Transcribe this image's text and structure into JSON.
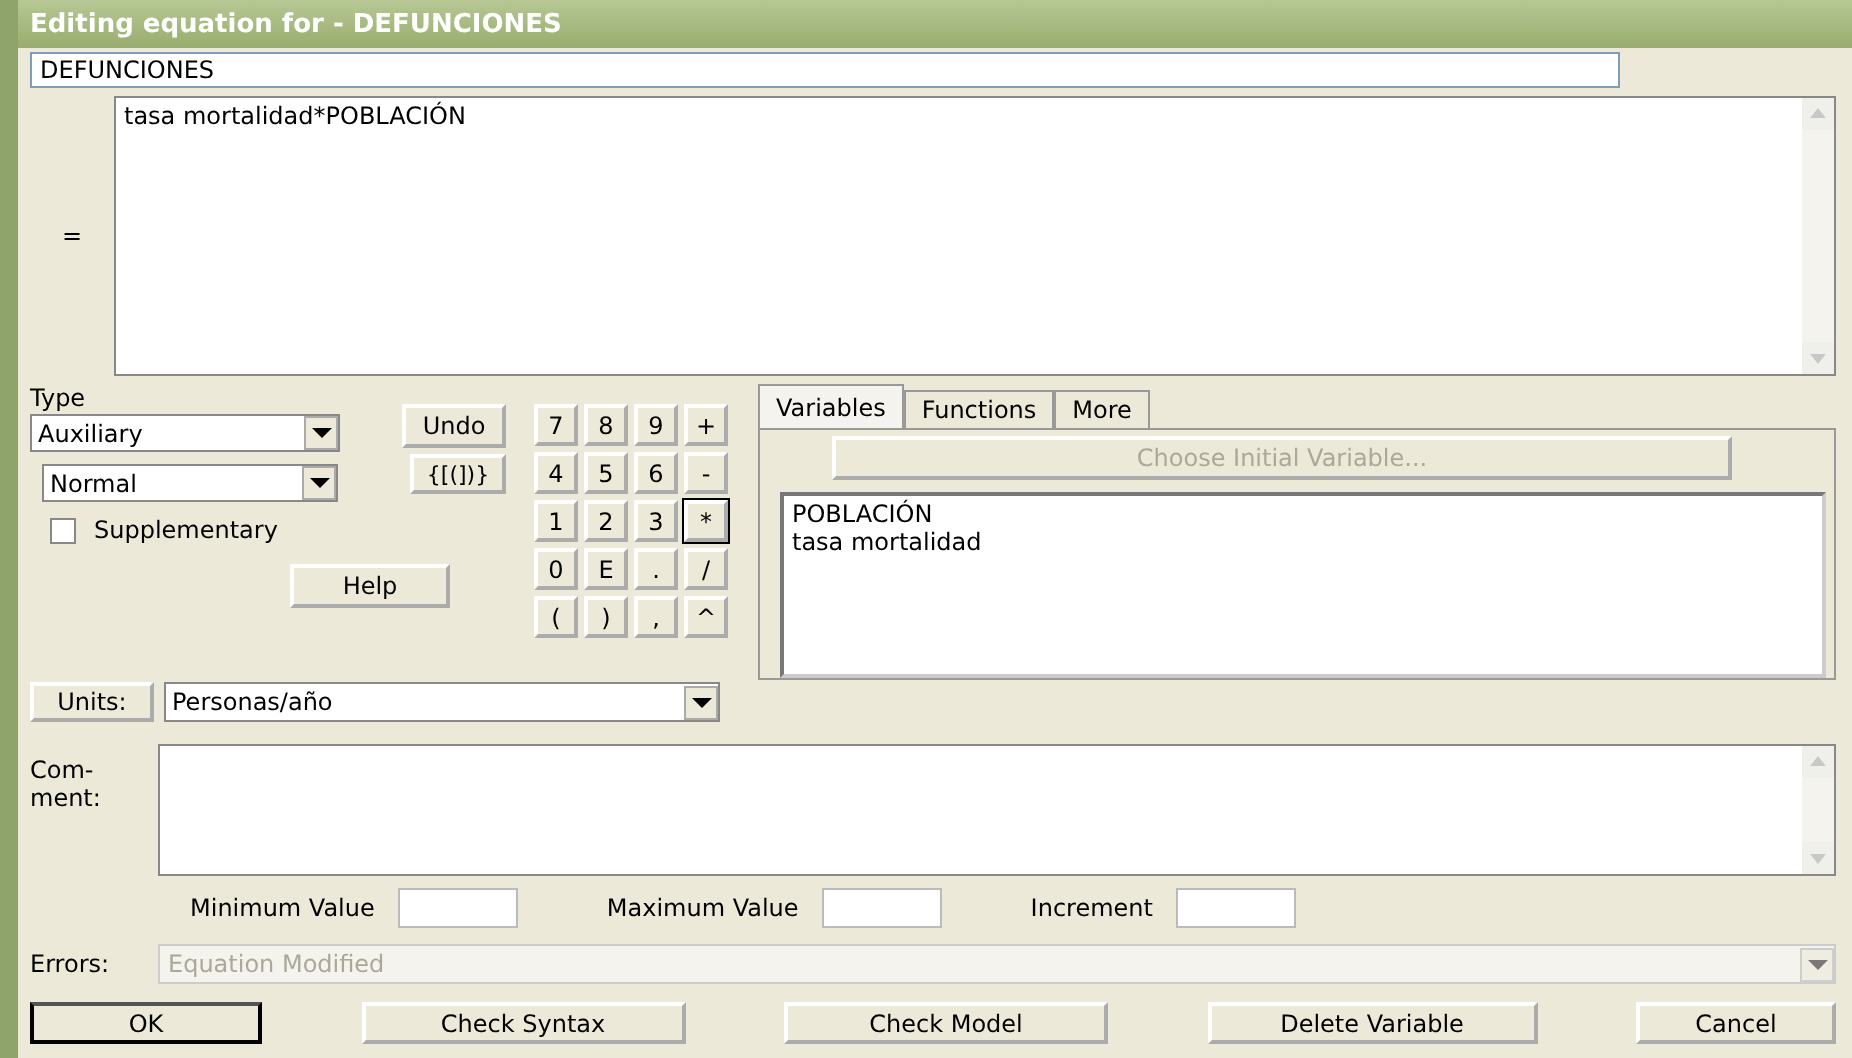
{
  "window": {
    "title": "Editing equation for - DEFUNCIONES"
  },
  "name_field": {
    "value": "DEFUNCIONES"
  },
  "equals_label": "=",
  "equation": {
    "value": "tasa mortalidad*POBLACIÓN"
  },
  "type": {
    "label": "Type",
    "value": "Auxiliary",
    "subtype": "Normal"
  },
  "supplementary": {
    "label": "Supplementary",
    "checked": false
  },
  "undo_button": "Undo",
  "brackets_button": "{[(])}",
  "help_button": "Help",
  "keypad": [
    {
      "key": "7",
      "focused": false
    },
    {
      "key": "8",
      "focused": false
    },
    {
      "key": "9",
      "focused": false
    },
    {
      "key": "+",
      "focused": false
    },
    {
      "key": "4",
      "focused": false
    },
    {
      "key": "5",
      "focused": false
    },
    {
      "key": "6",
      "focused": false
    },
    {
      "key": "-",
      "focused": false
    },
    {
      "key": "1",
      "focused": false
    },
    {
      "key": "2",
      "focused": false
    },
    {
      "key": "3",
      "focused": false
    },
    {
      "key": "*",
      "focused": true
    },
    {
      "key": "0",
      "focused": false
    },
    {
      "key": "E",
      "focused": false
    },
    {
      "key": ".",
      "focused": false
    },
    {
      "key": "/",
      "focused": false
    },
    {
      "key": "(",
      "focused": false
    },
    {
      "key": ")",
      "focused": false
    },
    {
      "key": ",",
      "focused": false
    },
    {
      "key": "^",
      "focused": false
    }
  ],
  "tabs": [
    {
      "label": "Variables",
      "selected": true
    },
    {
      "label": "Functions",
      "selected": false
    },
    {
      "label": "More",
      "selected": false
    }
  ],
  "choose_initial": {
    "label": "Choose Initial Variable...",
    "disabled": true
  },
  "variables": [
    "POBLACIÓN",
    "tasa mortalidad"
  ],
  "units": {
    "label": "Units:",
    "value": "Personas/año"
  },
  "comment": {
    "label": "Com-\nment:"
  },
  "ranges": [
    {
      "label": "Minimum Value"
    },
    {
      "label": "Maximum Value"
    },
    {
      "label": "Increment"
    }
  ],
  "errors": {
    "label": "Errors:",
    "value": "Equation Modified",
    "disabled": true
  },
  "buttons": [
    {
      "label": "OK",
      "default": true
    },
    {
      "label": "Check Syntax",
      "default": false
    },
    {
      "label": "Check Model",
      "default": false
    },
    {
      "label": "Delete Variable",
      "default": false
    },
    {
      "label": "Cancel",
      "default": false
    }
  ]
}
